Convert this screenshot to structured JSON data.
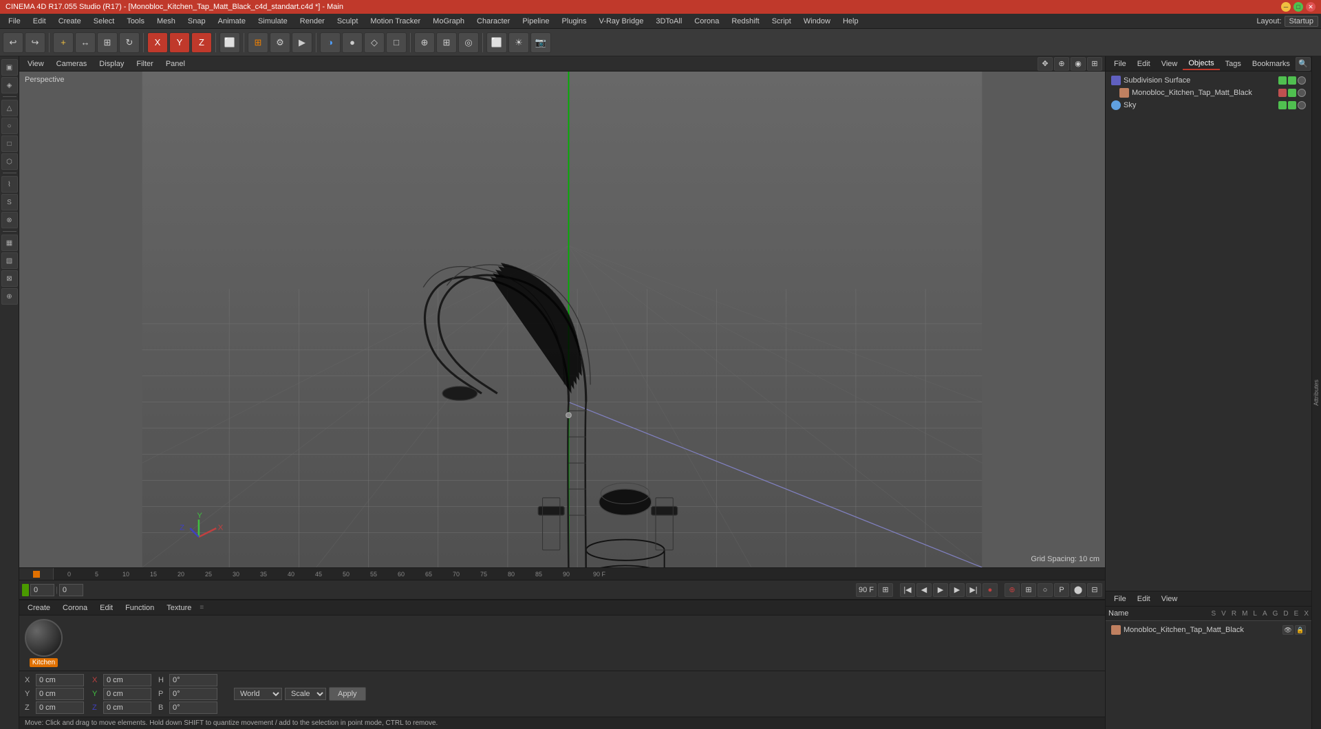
{
  "titlebar": {
    "title": "CINEMA 4D R17.055 Studio (R17) - [Monobloc_Kitchen_Tap_Matt_Black_c4d_standart.c4d *] - Main",
    "layout_label": "Layout:",
    "layout_value": "Startup"
  },
  "menubar": {
    "items": [
      "File",
      "Edit",
      "Create",
      "Select",
      "Tools",
      "Mesh",
      "Snap",
      "Animate",
      "Simulate",
      "Render",
      "Sculpt",
      "Motion Tracker",
      "MoGraph",
      "Character",
      "Pipeline",
      "Plugins",
      "V-Ray Bridge",
      "3DToAll",
      "Corona",
      "Redshift",
      "Script",
      "Window",
      "Help"
    ]
  },
  "toolbar": {
    "undo_label": "←",
    "redo_label": "→"
  },
  "viewport": {
    "label": "Perspective",
    "grid_info": "Grid Spacing: 10 cm",
    "menubar_items": [
      "View",
      "Cameras",
      "Display",
      "Filter",
      "Panel"
    ],
    "icons": [
      "⊕",
      "◎",
      "⊞"
    ]
  },
  "left_toolbar": {
    "tools": [
      "△",
      "○",
      "□",
      "◇",
      "⬡",
      "—",
      "⌇",
      "S",
      "⊗",
      "⚬",
      "▦",
      "▧"
    ]
  },
  "right_panel": {
    "tabs": [
      "File",
      "Edit",
      "View",
      "Objects",
      "Tags",
      "Bookmarks"
    ],
    "objects": [
      {
        "name": "Subdivision Surface",
        "icon_color": "#a0a0ff",
        "indent": 0,
        "check1": "green",
        "check2": "green"
      },
      {
        "name": "Monobloc_Kitchen_Tap_Matt_Black",
        "icon_color": "#c08060",
        "indent": 1,
        "check1": "red",
        "check2": "green"
      },
      {
        "name": "Sky",
        "icon_color": "#60a0ff",
        "indent": 0,
        "check1": "green",
        "check2": "green"
      }
    ],
    "bottom_tabs": [
      "File",
      "Edit",
      "View"
    ],
    "attr_header": "Name",
    "attr_cols": [
      "S",
      "V",
      "R",
      "M",
      "L",
      "A",
      "G",
      "D",
      "E",
      "X"
    ],
    "selected_object": "Monobloc_Kitchen_Tap_Matt_Black"
  },
  "timeline": {
    "frames": [
      "0",
      "5",
      "10",
      "15",
      "20",
      "25",
      "30",
      "35",
      "40",
      "45",
      "50",
      "55",
      "60",
      "65",
      "70",
      "75",
      "80",
      "85",
      "90"
    ],
    "end_frame": "90 F",
    "current_frame": "0 F",
    "frame_input": "0",
    "min_frame": "0 F",
    "max_frame": "90 F"
  },
  "mat_panel": {
    "tabs": [
      "Create",
      "Corona",
      "Edit",
      "Function",
      "Texture"
    ],
    "material_name": "Kitchen",
    "material_label": "Kitchen"
  },
  "coord_bar": {
    "x_pos": "0 cm",
    "y_pos": "0 cm",
    "z_pos": "0 cm",
    "x_size": "0 cm",
    "y_size": "0 cm",
    "z_size": "0 cm",
    "rot_h": "0°",
    "rot_p": "0°",
    "rot_b": "0°",
    "coord_system": "World",
    "scale_mode": "Scale",
    "apply_label": "Apply",
    "axis_x": "X",
    "axis_y": "Y",
    "axis_z": "Z"
  },
  "status_bar": {
    "message": "Move: Click and drag to move elements. Hold down SHIFT to quantize movement / add to the selection in point mode, CTRL to remove."
  },
  "icons": {
    "play": "▶",
    "prev": "◀◀",
    "next": "▶▶",
    "stop": "■",
    "record": "●"
  }
}
